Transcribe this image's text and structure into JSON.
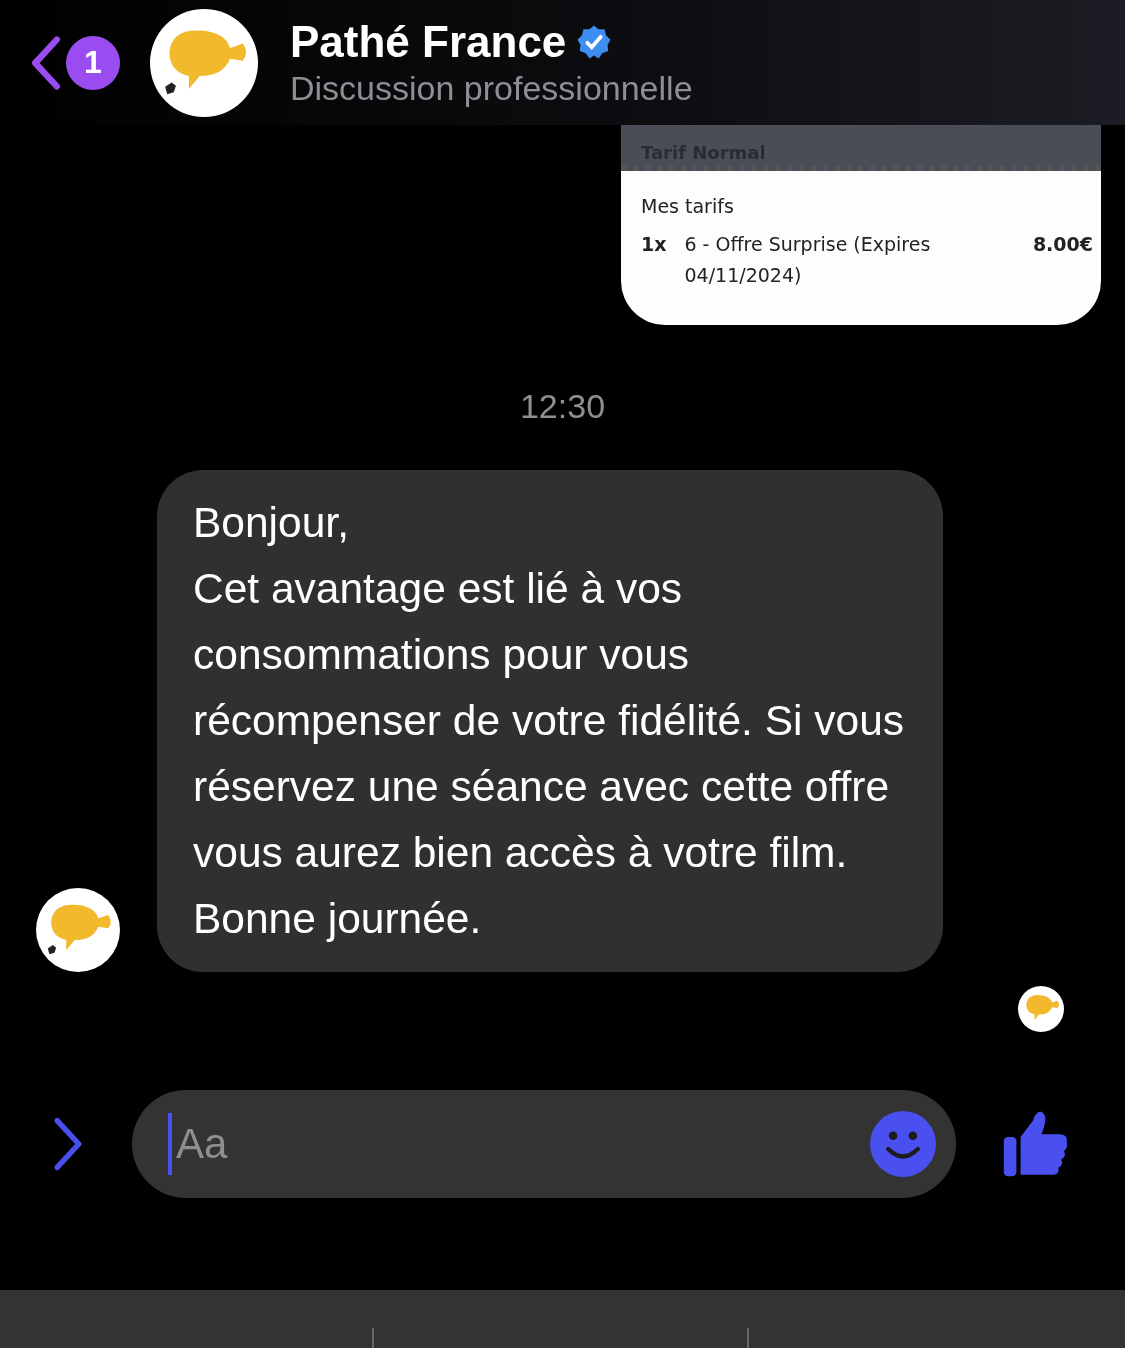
{
  "header": {
    "back_badge": "1",
    "title": "Pathé France",
    "verified": true,
    "subtitle": "Discussion professionnelle"
  },
  "image_message": {
    "header": "Tarif Normal",
    "section": "Mes tarifs",
    "rows": [
      {
        "qty": "1x",
        "label": "6 - Offre Surprise (Expires 04/11/2024)",
        "price": "8.00€"
      }
    ]
  },
  "timestamp": "12:30",
  "message": {
    "text": "Bonjour,\nCet avantage est lié à vos consommations pour vous récompenser de votre fidélité. Si vous réservez une séance avec cette offre vous aurez bien accès à votre film. Bonne journée."
  },
  "composer": {
    "placeholder": "Aa"
  }
}
